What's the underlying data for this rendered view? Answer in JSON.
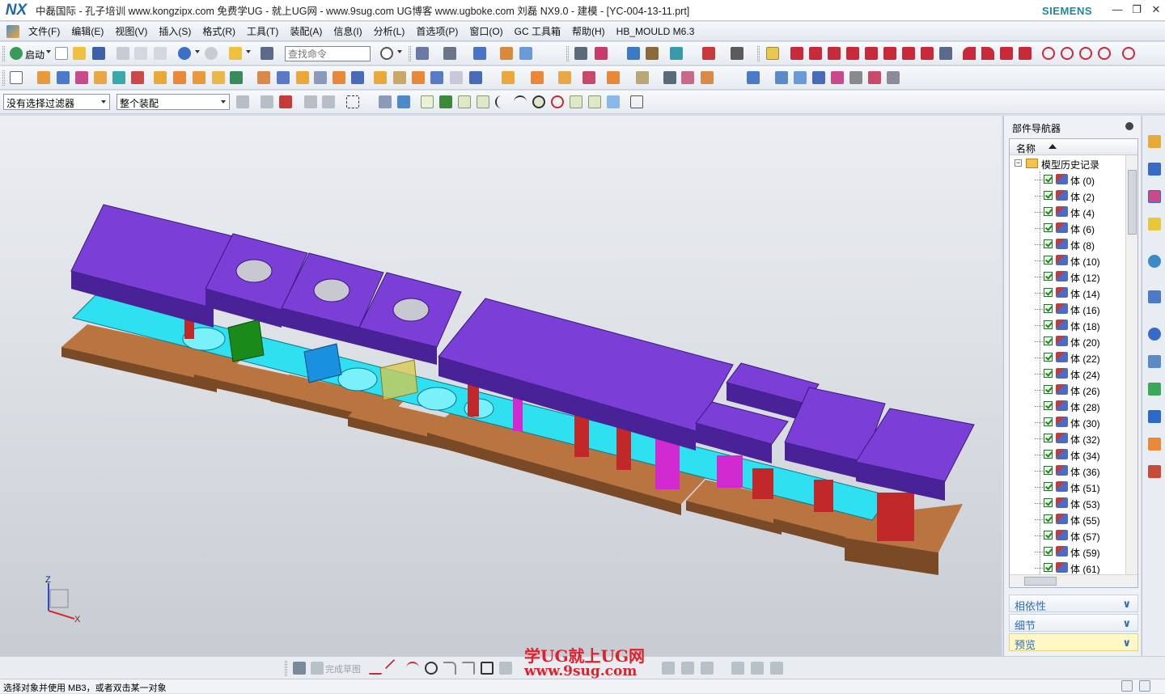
{
  "window": {
    "logo": "NX",
    "title": "中磊国际 - 孔子培训 www.kongzipx.com 免费学UG - 就上UG网 - www.9sug.com  UG博客 www.ugboke.com 刘磊  NX9.0 - 建模 - [YC-004-13-11.prt]",
    "brand": "SIEMENS",
    "brand_color": "#1a8a9a"
  },
  "menu": {
    "items": [
      "文件(F)",
      "编辑(E)",
      "视图(V)",
      "插入(S)",
      "格式(R)",
      "工具(T)",
      "装配(A)",
      "信息(I)",
      "分析(L)",
      "首选项(P)",
      "窗口(O)",
      "GC 工具箱",
      "帮助(H)",
      "HB_MOULD M6.3"
    ]
  },
  "toolbar1": {
    "start_label": "启动",
    "search_placeholder": "查找命令"
  },
  "toolbar3": {
    "selection_filter": "没有选择过滤器",
    "assembly_scope": "整个装配"
  },
  "navigator": {
    "title": "部件导航器",
    "column_name": "名称",
    "root": "模型历史记录",
    "items": [
      "体 (0)",
      "体 (2)",
      "体 (4)",
      "体 (6)",
      "体 (8)",
      "体 (10)",
      "体 (12)",
      "体 (14)",
      "体 (16)",
      "体 (18)",
      "体 (20)",
      "体 (22)",
      "体 (24)",
      "体 (26)",
      "体 (28)",
      "体 (30)",
      "体 (32)",
      "体 (34)",
      "体 (36)",
      "体 (51)",
      "体 (53)",
      "体 (55)",
      "体 (57)",
      "体 (59)",
      "体 (61)"
    ],
    "sections": [
      "相依性",
      "细节",
      "预览"
    ]
  },
  "viewport": {
    "axis_z": "Z",
    "axis_x": "X"
  },
  "bottom_toolbar": {
    "finish_sketch": "完成草图"
  },
  "watermark": {
    "line1": "学UG就上UG网",
    "line2": "www.9sug.com"
  },
  "status": {
    "text": "选择对象并使用 MB3，或者双击某一对象"
  },
  "colors": {
    "plate_purple": "#7b3fd8",
    "base_brown": "#a8683a",
    "strip_cyan": "#2ee0f0",
    "punch_red": "#c0282a",
    "accent_blue": "#2f6db2"
  }
}
